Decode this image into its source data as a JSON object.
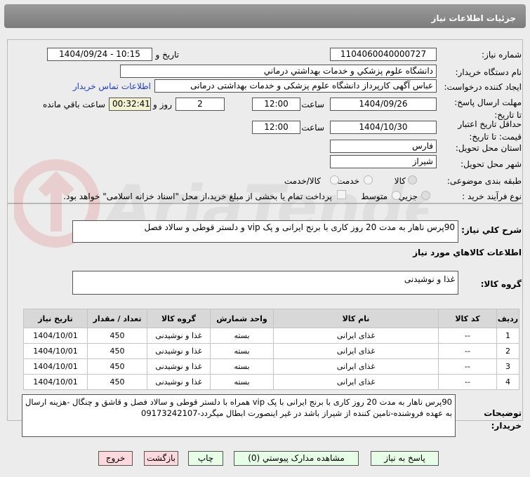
{
  "header": {
    "title": "جزئیات اطلاعات نیاز"
  },
  "form": {
    "need_number_label": "شماره نیاز:",
    "need_number": "1104060040000727",
    "announce_label": "تاریخ و ساعت اعلان عمومي:",
    "announce_value": "1404/09/24 - 10:15",
    "buyer_label": "نام دستگاه خريدار:",
    "buyer": "دانشگاه علوم پزشكي و خدمات بهداشتي درماني",
    "creator_label": "ایجاد کننده درخواست:",
    "creator": "عباس آگهی کارپرداز دانشگاه علوم پزشکی و خدمات بهداشتی درمانی",
    "contact_link": "اطلاعات تماس خریدار",
    "deadline_label": "مهلت ارسال پاسخ: تا تاریخ:",
    "deadline_date": "1404/09/26",
    "time_label": "ساعت",
    "deadline_time": "12:00",
    "days": "2",
    "days_label": "روز و",
    "remaining": "00:32:41",
    "remaining_label": "ساعت باقي مانده",
    "validity_label": "حداقل تاریخ اعتبار قیمت: تا تاریخ:",
    "validity_date": "1404/10/30",
    "validity_time": "12:00",
    "province_label": "استان محل تحویل:",
    "province": "فارس",
    "city_label": "شهر محل تحویل:",
    "city": "شیراز",
    "category_label": "طبقه بندی موضوعی:",
    "category_options": [
      "کالا",
      "خدمت",
      "کالا/خدمت"
    ],
    "process_label": "نوع فرآیند خرید :",
    "process_options": [
      "جزیي",
      "متوسط"
    ],
    "payment_note": "پرداخت تمام یا بخشی از مبلغ خرید،از محل \"اسناد خزانه اسلامی\" خواهد بود."
  },
  "summary": {
    "label": "شرح كلي نياز:",
    "value": "90پرس ناهار به مدت 20 روز کاری با برنج ایرانی و پک vip و دلستر قوطی و سالاد فصل"
  },
  "goods": {
    "section_title": "اطلاعات كالاهاي مورد نياز",
    "group_label": "گروه کالا:",
    "group_value": "غذا و نوشیدنی",
    "columns": [
      "ردیف",
      "کد کالا",
      "نام کالا",
      "واحد شمارش",
      "گروه کالا",
      "تعداد / مقدار",
      "تاریخ نیاز"
    ],
    "rows": [
      [
        "1",
        "--",
        "غذای ایرانی",
        "بسته",
        "غذا و نوشیدنی",
        "450",
        "1404/10/01"
      ],
      [
        "2",
        "--",
        "غذای ایرانی",
        "بسته",
        "غذا و نوشیدنی",
        "450",
        "1404/10/01"
      ],
      [
        "3",
        "--",
        "غذای ایرانی",
        "بسته",
        "غذا و نوشیدنی",
        "450",
        "1404/10/01"
      ],
      [
        "4",
        "--",
        "غذای ایرانی",
        "بسته",
        "غذا و نوشیدنی",
        "450",
        "1404/10/01"
      ]
    ]
  },
  "notes": {
    "label": "توضیحات خریدار:",
    "value": "90پرس ناهار به مدت 20 روز کاری با برنج ایرانی با پک vip همراه با دلستر قوطی و سالاد فصل و قاشق و چنگال -هزینه ارسال به عهده فروشنده-تامین کننده از شیراز باشد در غیر اینصورت ابطال میگردد-09173242107"
  },
  "buttons": {
    "reply": "پاسخ به نیاز",
    "attachments": "مشاهده مدارک پیوستي (0)",
    "print": "چاپ",
    "back": "بازگشت",
    "exit": "خروج"
  },
  "watermark": "AriaTender.neT"
}
